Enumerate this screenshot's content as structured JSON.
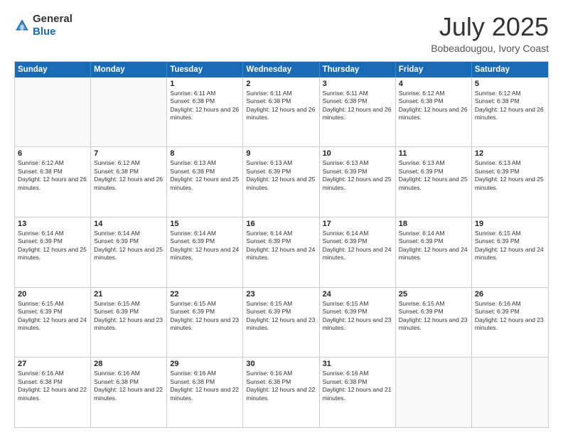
{
  "header": {
    "logo": {
      "line1": "General",
      "line2": "Blue"
    },
    "title": "July 2025",
    "location": "Bobeadougou, Ivory Coast"
  },
  "days_of_week": [
    "Sunday",
    "Monday",
    "Tuesday",
    "Wednesday",
    "Thursday",
    "Friday",
    "Saturday"
  ],
  "weeks": [
    [
      {
        "day": "",
        "empty": true
      },
      {
        "day": "",
        "empty": true
      },
      {
        "day": "1",
        "sunrise": "6:11 AM",
        "sunset": "6:38 PM",
        "daylight": "12 hours and 26 minutes."
      },
      {
        "day": "2",
        "sunrise": "6:11 AM",
        "sunset": "6:38 PM",
        "daylight": "12 hours and 26 minutes."
      },
      {
        "day": "3",
        "sunrise": "6:11 AM",
        "sunset": "6:38 PM",
        "daylight": "12 hours and 26 minutes."
      },
      {
        "day": "4",
        "sunrise": "6:12 AM",
        "sunset": "6:38 PM",
        "daylight": "12 hours and 26 minutes."
      },
      {
        "day": "5",
        "sunrise": "6:12 AM",
        "sunset": "6:38 PM",
        "daylight": "12 hours and 26 minutes."
      }
    ],
    [
      {
        "day": "6",
        "sunrise": "6:12 AM",
        "sunset": "6:38 PM",
        "daylight": "12 hours and 26 minutes."
      },
      {
        "day": "7",
        "sunrise": "6:12 AM",
        "sunset": "6:38 PM",
        "daylight": "12 hours and 26 minutes."
      },
      {
        "day": "8",
        "sunrise": "6:13 AM",
        "sunset": "6:38 PM",
        "daylight": "12 hours and 25 minutes."
      },
      {
        "day": "9",
        "sunrise": "6:13 AM",
        "sunset": "6:39 PM",
        "daylight": "12 hours and 25 minutes."
      },
      {
        "day": "10",
        "sunrise": "6:13 AM",
        "sunset": "6:39 PM",
        "daylight": "12 hours and 25 minutes."
      },
      {
        "day": "11",
        "sunrise": "6:13 AM",
        "sunset": "6:39 PM",
        "daylight": "12 hours and 25 minutes."
      },
      {
        "day": "12",
        "sunrise": "6:13 AM",
        "sunset": "6:39 PM",
        "daylight": "12 hours and 25 minutes."
      }
    ],
    [
      {
        "day": "13",
        "sunrise": "6:14 AM",
        "sunset": "6:39 PM",
        "daylight": "12 hours and 25 minutes."
      },
      {
        "day": "14",
        "sunrise": "6:14 AM",
        "sunset": "6:39 PM",
        "daylight": "12 hours and 25 minutes."
      },
      {
        "day": "15",
        "sunrise": "6:14 AM",
        "sunset": "6:39 PM",
        "daylight": "12 hours and 24 minutes."
      },
      {
        "day": "16",
        "sunrise": "6:14 AM",
        "sunset": "6:39 PM",
        "daylight": "12 hours and 24 minutes."
      },
      {
        "day": "17",
        "sunrise": "6:14 AM",
        "sunset": "6:39 PM",
        "daylight": "12 hours and 24 minutes."
      },
      {
        "day": "18",
        "sunrise": "6:14 AM",
        "sunset": "6:39 PM",
        "daylight": "12 hours and 24 minutes."
      },
      {
        "day": "19",
        "sunrise": "6:15 AM",
        "sunset": "6:39 PM",
        "daylight": "12 hours and 24 minutes."
      }
    ],
    [
      {
        "day": "20",
        "sunrise": "6:15 AM",
        "sunset": "6:39 PM",
        "daylight": "12 hours and 24 minutes."
      },
      {
        "day": "21",
        "sunrise": "6:15 AM",
        "sunset": "6:39 PM",
        "daylight": "12 hours and 23 minutes."
      },
      {
        "day": "22",
        "sunrise": "6:15 AM",
        "sunset": "6:39 PM",
        "daylight": "12 hours and 23 minutes."
      },
      {
        "day": "23",
        "sunrise": "6:15 AM",
        "sunset": "6:39 PM",
        "daylight": "12 hours and 23 minutes."
      },
      {
        "day": "24",
        "sunrise": "6:15 AM",
        "sunset": "6:39 PM",
        "daylight": "12 hours and 23 minutes."
      },
      {
        "day": "25",
        "sunrise": "6:15 AM",
        "sunset": "6:39 PM",
        "daylight": "12 hours and 23 minutes."
      },
      {
        "day": "26",
        "sunrise": "6:16 AM",
        "sunset": "6:39 PM",
        "daylight": "12 hours and 23 minutes."
      }
    ],
    [
      {
        "day": "27",
        "sunrise": "6:16 AM",
        "sunset": "6:38 PM",
        "daylight": "12 hours and 22 minutes."
      },
      {
        "day": "28",
        "sunrise": "6:16 AM",
        "sunset": "6:38 PM",
        "daylight": "12 hours and 22 minutes."
      },
      {
        "day": "29",
        "sunrise": "6:16 AM",
        "sunset": "6:38 PM",
        "daylight": "12 hours and 22 minutes."
      },
      {
        "day": "30",
        "sunrise": "6:16 AM",
        "sunset": "6:38 PM",
        "daylight": "12 hours and 22 minutes."
      },
      {
        "day": "31",
        "sunrise": "6:16 AM",
        "sunset": "6:38 PM",
        "daylight": "12 hours and 21 minutes."
      },
      {
        "day": "",
        "empty": true
      },
      {
        "day": "",
        "empty": true
      }
    ]
  ]
}
